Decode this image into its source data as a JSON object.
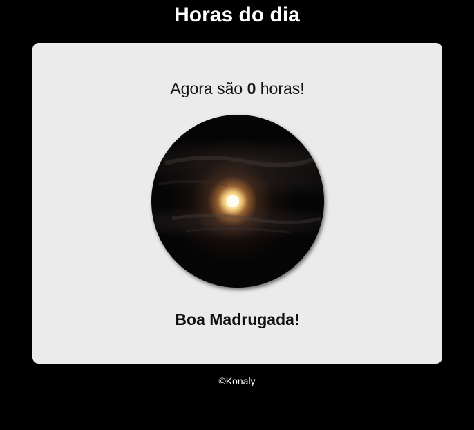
{
  "header": {
    "title": "Horas do dia"
  },
  "main": {
    "time_prefix": "Agora são",
    "hour": "0",
    "time_suffix": "horas!",
    "image": {
      "icon": "night-moon-photo",
      "description": ""
    },
    "greeting": "Boa Madrugada!"
  },
  "footer": {
    "text": "©Konaly"
  },
  "colors": {
    "background": "#000000",
    "card": "#ebebeb",
    "text": "#111111",
    "title": "#ffffff"
  }
}
